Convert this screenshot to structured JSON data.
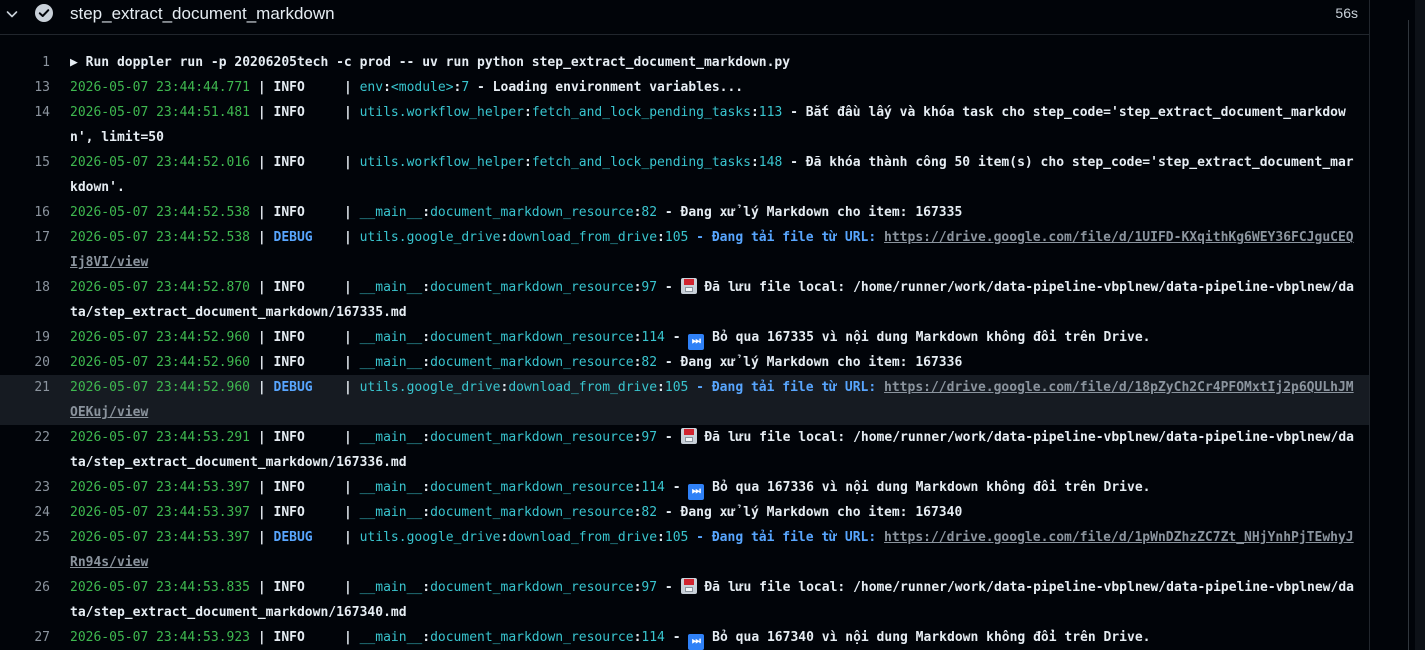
{
  "step": {
    "title": "step_extract_document_markdown",
    "duration": "56s",
    "status": "success"
  },
  "colors": {
    "timestamp": "#3fb950",
    "module": "#39c5cf",
    "debug": "#58a6ff",
    "text": "#e6edf3",
    "line_number": "#8b949e"
  },
  "log": {
    "l1": {
      "num": "1",
      "marker": "▶",
      "text": " Run doppler run -p 20206205tech -c prod -- uv run python step_extract_document_markdown.py"
    },
    "l13": {
      "num": "13",
      "ts": "2026-05-07 23:44:44.771",
      "sep": " | ",
      "level": "INFO",
      "pipe": "     | ",
      "module": "env",
      "c1": ":",
      "func": "<module>",
      "c2": ":",
      "lineno": "7",
      "msg": " - Loading environment variables..."
    },
    "l14": {
      "num": "14",
      "ts": "2026-05-07 23:44:51.481",
      "sep": " | ",
      "level": "INFO",
      "pipe": "     | ",
      "module": "utils.workflow_helper",
      "c1": ":",
      "func": "fetch_and_lock_pending_tasks",
      "c2": ":",
      "lineno": "113",
      "msg": " - Bắt đầu lấy và khóa task cho step_code='step_extract_document_markdown', limit=50"
    },
    "l15": {
      "num": "15",
      "ts": "2026-05-07 23:44:52.016",
      "sep": " | ",
      "level": "INFO",
      "pipe": "     | ",
      "module": "utils.workflow_helper",
      "c1": ":",
      "func": "fetch_and_lock_pending_tasks",
      "c2": ":",
      "lineno": "148",
      "msg": " - Đã khóa thành công 50 item(s) cho step_code='step_extract_document_markdown'."
    },
    "l16": {
      "num": "16",
      "ts": "2026-05-07 23:44:52.538",
      "sep": " | ",
      "level": "INFO",
      "pipe": "     | ",
      "module": "__main__",
      "c1": ":",
      "func": "document_markdown_resource",
      "c2": ":",
      "lineno": "82",
      "msg": " - Đang xử lý Markdown cho item: 167335"
    },
    "l17": {
      "num": "17",
      "ts": "2026-05-07 23:44:52.538",
      "sep": " | ",
      "level": "DEBUG",
      "pipe": "    | ",
      "module": "utils.google_drive",
      "c1": ":",
      "func": "download_from_drive",
      "c2": ":",
      "lineno": "105",
      "msg": " - Đang tải file từ URL: ",
      "url": "https://drive.google.com/file/d/1UIFD-KXqithKg6WEY36FCJguCEQIj8VI/view"
    },
    "l18": {
      "num": "18",
      "ts": "2026-05-07 23:44:52.870",
      "sep": " | ",
      "level": "INFO",
      "pipe": "     | ",
      "module": "__main__",
      "c1": ":",
      "func": "document_markdown_resource",
      "c2": ":",
      "lineno": "97",
      "msg_pre": " - ",
      "emoji": "floppy-disk",
      "msg": " Đã lưu file local: /home/runner/work/data-pipeline-vbplnew/data-pipeline-vbplnew/data/step_extract_document_markdown/167335.md"
    },
    "l19": {
      "num": "19",
      "ts": "2026-05-07 23:44:52.960",
      "sep": " | ",
      "level": "INFO",
      "pipe": "     | ",
      "module": "__main__",
      "c1": ":",
      "func": "document_markdown_resource",
      "c2": ":",
      "lineno": "114",
      "msg_pre": " - ",
      "emoji": "fast-forward",
      "msg": " Bỏ qua 167335 vì nội dung Markdown không đổi trên Drive."
    },
    "l20": {
      "num": "20",
      "ts": "2026-05-07 23:44:52.960",
      "sep": " | ",
      "level": "INFO",
      "pipe": "     | ",
      "module": "__main__",
      "c1": ":",
      "func": "document_markdown_resource",
      "c2": ":",
      "lineno": "82",
      "msg": " - Đang xử lý Markdown cho item: 167336"
    },
    "l21": {
      "num": "21",
      "ts": "2026-05-07 23:44:52.960",
      "sep": " | ",
      "level": "DEBUG",
      "pipe": "    | ",
      "module": "utils.google_drive",
      "c1": ":",
      "func": "download_from_drive",
      "c2": ":",
      "lineno": "105",
      "msg": " - Đang tải file từ URL: ",
      "url": "https://drive.google.com/file/d/18pZyCh2Cr4PFOMxtIj2p6QULhJMOEKuj/view"
    },
    "l22": {
      "num": "22",
      "ts": "2026-05-07 23:44:53.291",
      "sep": " | ",
      "level": "INFO",
      "pipe": "     | ",
      "module": "__main__",
      "c1": ":",
      "func": "document_markdown_resource",
      "c2": ":",
      "lineno": "97",
      "msg_pre": " - ",
      "emoji": "floppy-disk",
      "msg": " Đã lưu file local: /home/runner/work/data-pipeline-vbplnew/data-pipeline-vbplnew/data/step_extract_document_markdown/167336.md"
    },
    "l23": {
      "num": "23",
      "ts": "2026-05-07 23:44:53.397",
      "sep": " | ",
      "level": "INFO",
      "pipe": "     | ",
      "module": "__main__",
      "c1": ":",
      "func": "document_markdown_resource",
      "c2": ":",
      "lineno": "114",
      "msg_pre": " - ",
      "emoji": "fast-forward",
      "msg": " Bỏ qua 167336 vì nội dung Markdown không đổi trên Drive."
    },
    "l24": {
      "num": "24",
      "ts": "2026-05-07 23:44:53.397",
      "sep": " | ",
      "level": "INFO",
      "pipe": "     | ",
      "module": "__main__",
      "c1": ":",
      "func": "document_markdown_resource",
      "c2": ":",
      "lineno": "82",
      "msg": " - Đang xử lý Markdown cho item: 167340"
    },
    "l25": {
      "num": "25",
      "ts": "2026-05-07 23:44:53.397",
      "sep": " | ",
      "level": "DEBUG",
      "pipe": "    | ",
      "module": "utils.google_drive",
      "c1": ":",
      "func": "download_from_drive",
      "c2": ":",
      "lineno": "105",
      "msg": " - Đang tải file từ URL: ",
      "url": "https://drive.google.com/file/d/1pWnDZhzZC7Zt_NHjYnhPjTEwhyJRn94s/view"
    },
    "l26": {
      "num": "26",
      "ts": "2026-05-07 23:44:53.835",
      "sep": " | ",
      "level": "INFO",
      "pipe": "     | ",
      "module": "__main__",
      "c1": ":",
      "func": "document_markdown_resource",
      "c2": ":",
      "lineno": "97",
      "msg_pre": " - ",
      "emoji": "floppy-disk",
      "msg": " Đã lưu file local: /home/runner/work/data-pipeline-vbplnew/data-pipeline-vbplnew/data/step_extract_document_markdown/167340.md"
    },
    "l27": {
      "num": "27",
      "ts": "2026-05-07 23:44:53.923",
      "sep": " | ",
      "level": "INFO",
      "pipe": "     | ",
      "module": "__main__",
      "c1": ":",
      "func": "document_markdown_resource",
      "c2": ":",
      "lineno": "114",
      "msg_pre": " - ",
      "emoji": "fast-forward",
      "msg": " Bỏ qua 167340 vì nội dung Markdown không đổi trên Drive."
    }
  }
}
